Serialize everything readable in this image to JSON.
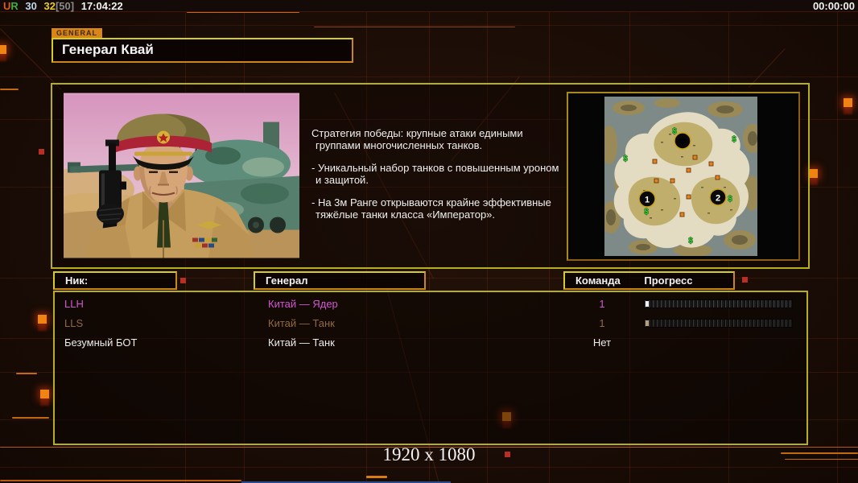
{
  "status_bar": {
    "label_u": "U",
    "label_r": "R",
    "stat_blue": "30",
    "stat_yellow": "32",
    "stat_max": "[50]",
    "clock": "17:04:22",
    "match_timer": "00:00:00"
  },
  "header": {
    "tab_label": "GENERAL",
    "title": "Генерал Квай"
  },
  "general_info": {
    "description_lines": [
      [
        "Стратегия победы: крупные атаки едиными",
        "группами многочисленных танков."
      ],
      [
        "- Уникальный набор танков с повышенным уроном",
        "и защитой."
      ],
      [
        "- На 3м Ранге открываются крайне эффективные",
        "тяжёлые танки класса «Император»."
      ]
    ]
  },
  "minimap": {
    "start_marker_1": "1",
    "start_marker_2": "2",
    "supply_symbol": "$"
  },
  "players": {
    "headers": {
      "nick": "Ник:",
      "general": "Генерал",
      "team": "Команда",
      "progress": "Прогресс"
    },
    "rows": [
      {
        "nick": "LLH",
        "general": "Китай — Ядер",
        "team": "1",
        "style": "color:#d355d3",
        "bar_style": "background:#f4eef6"
      },
      {
        "nick": "LLS",
        "general": "Китай — Танк",
        "team": "1",
        "style": "color:#b08050",
        "bar_style": "background:#dfc59c"
      },
      {
        "nick": "Безумный БОТ",
        "general": "Китай — Танк",
        "team": "Нет",
        "style": "color:#ececec"
      }
    ]
  },
  "footer": {
    "resolution": "1920 x 1080"
  },
  "theme": {
    "accent_yellow": "#c3ba20",
    "accent_orange": "#cf7c12",
    "border_yellow": "#b6ae1b",
    "glow_orange": "#f08312",
    "background": "#1b0d06"
  }
}
